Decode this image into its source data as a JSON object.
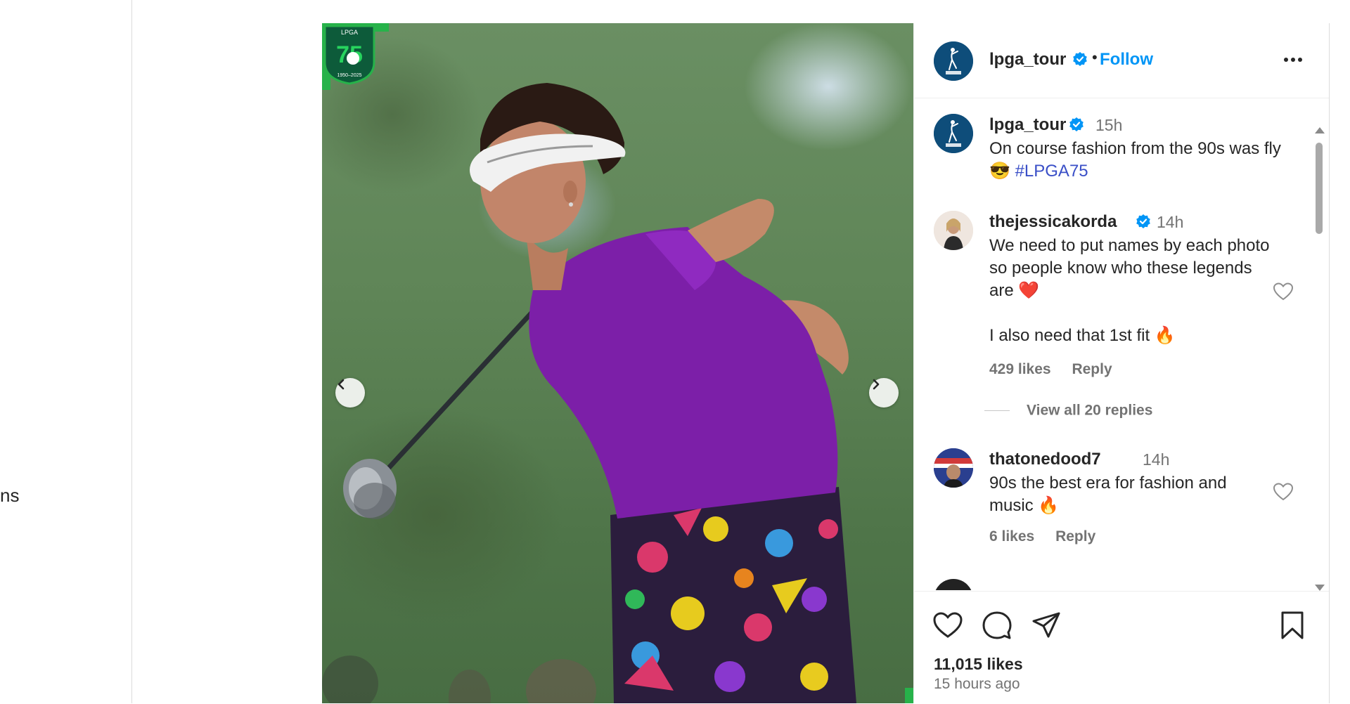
{
  "left_rail": {
    "partial_label": "ns"
  },
  "post": {
    "username": "lpga_tour",
    "follow_label": "Follow",
    "separator": "•",
    "badge": {
      "top": "LPGA",
      "number": "75",
      "years": "1950–2025"
    },
    "caption": {
      "username": "lpga_tour",
      "time": "15h",
      "text": "On course fashion from the 90s was fly",
      "emoji": "😎",
      "hashtag": "#LPGA75"
    },
    "comments": [
      {
        "username": "thejessicakorda",
        "verified": true,
        "time": "14h",
        "text": "We need to put names by each photo so people know who these legends are",
        "emoji": "❤️",
        "text2": "I also need that 1st fit",
        "emoji2": "🔥",
        "likes": "429 likes",
        "reply": "Reply",
        "view_replies": "View all 20 replies"
      },
      {
        "username": "thatonedood7",
        "verified": false,
        "time": "14h",
        "text": "90s the best era for fashion and music",
        "emoji": "🔥",
        "likes": "6 likes",
        "reply": "Reply"
      }
    ],
    "likes_count": "11,015 likes",
    "posted_ago": "15 hours ago"
  },
  "colors": {
    "accent_blue": "#0095f6",
    "hashtag": "#3a4fc7",
    "muted": "#737373",
    "brand_green": "#27b24a"
  },
  "icons": [
    "verified-icon",
    "more-options-icon",
    "heart-icon",
    "comment-icon",
    "share-icon",
    "save-icon",
    "chevron-left-icon",
    "chevron-right-icon"
  ]
}
